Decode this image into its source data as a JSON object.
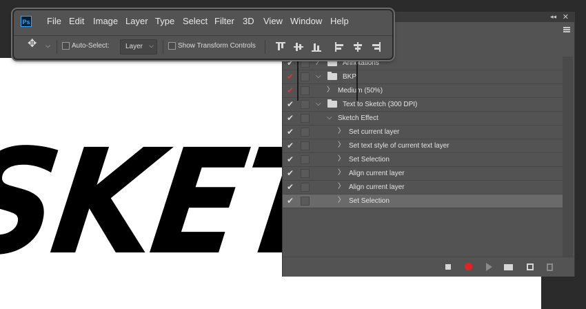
{
  "app": {
    "logo": "Ps"
  },
  "menu": [
    "File",
    "Edit",
    "Image",
    "Layer",
    "Type",
    "Select",
    "Filter",
    "3D",
    "View",
    "Window",
    "Help"
  ],
  "options": {
    "move_tool_icon": "move-icon",
    "auto_select_label": "Auto-Select:",
    "auto_select_checked": false,
    "auto_select_value": "Layer",
    "show_transform_label": "Show Transform Controls",
    "show_transform_checked": false,
    "align_icons": [
      "align-top-edges-icon",
      "align-vertical-centers-icon",
      "align-bottom-edges-icon",
      "align-left-edges-icon",
      "align-horizontal-centers-icon",
      "align-right-edges-icon"
    ]
  },
  "canvas": {
    "art_text": "SKETCH"
  },
  "actions_panel": {
    "rows": [
      {
        "check": "white",
        "indent": 0,
        "expander": "collapsed",
        "folder": true,
        "label": "Annotations"
      },
      {
        "check": "red",
        "indent": 0,
        "expander": "expanded",
        "folder": true,
        "label": "BKP"
      },
      {
        "check": "red",
        "indent": 1,
        "expander": "collapsed",
        "folder": false,
        "label": "Medium (50%)"
      },
      {
        "check": "white",
        "indent": 0,
        "expander": "expanded",
        "folder": true,
        "label": "Text to Sketch (300 DPI)"
      },
      {
        "check": "white",
        "indent": 1,
        "expander": "expanded",
        "folder": false,
        "label": "Sketch Effect"
      },
      {
        "check": "white",
        "indent": 2,
        "expander": "collapsed",
        "folder": false,
        "label": "Set current layer"
      },
      {
        "check": "white",
        "indent": 2,
        "expander": "collapsed",
        "folder": false,
        "label": "Set text style of current text layer"
      },
      {
        "check": "white",
        "indent": 2,
        "expander": "collapsed",
        "folder": false,
        "label": "Set Selection"
      },
      {
        "check": "white",
        "indent": 2,
        "expander": "collapsed",
        "folder": false,
        "label": "Align current layer"
      },
      {
        "check": "white",
        "indent": 2,
        "expander": "collapsed",
        "folder": false,
        "label": "Align current layer"
      },
      {
        "check": "white",
        "indent": 2,
        "expander": "collapsed",
        "folder": false,
        "label": "Set Selection",
        "selected": true
      }
    ],
    "footer_icons": [
      "stop-icon",
      "record-icon",
      "play-icon",
      "new-set-icon",
      "new-action-icon",
      "delete-icon"
    ],
    "colors": {
      "record": "#e02424",
      "check_red": "#d13c3c"
    }
  }
}
